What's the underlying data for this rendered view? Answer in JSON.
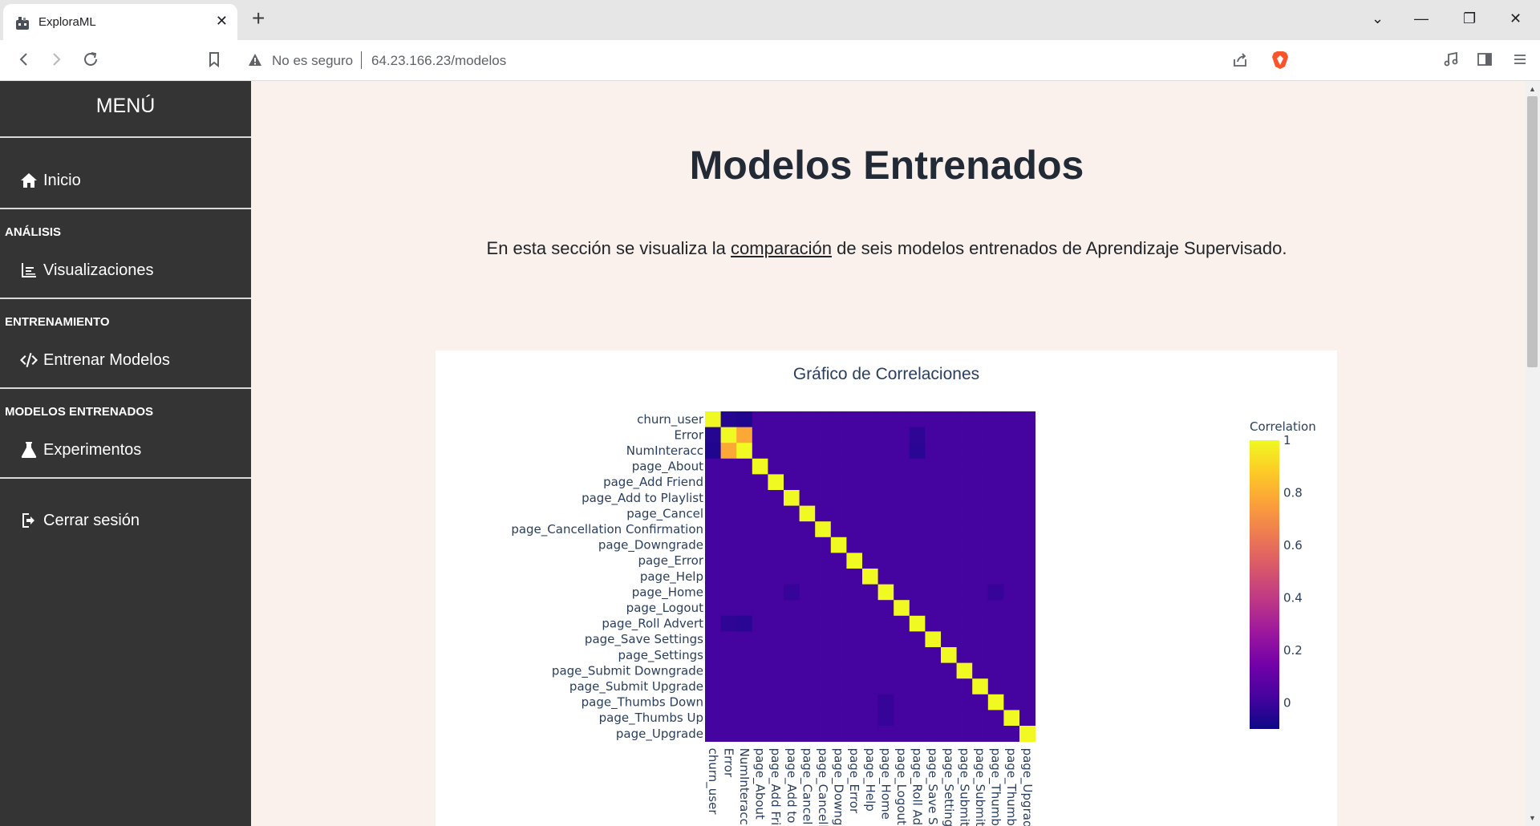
{
  "browser": {
    "tab_title": "ExploraML",
    "tab_close": "✕",
    "new_tab": "+",
    "insecure_label": "No es seguro",
    "url": "64.23.166.23/modelos",
    "window_controls": [
      "⌄",
      "—",
      "❐",
      "✕"
    ]
  },
  "sidebar": {
    "menu_title": "MENÚ",
    "home_label": "Inicio",
    "section_analysis": "ANÁLISIS",
    "visualizations_label": "Visualizaciones",
    "section_training": "ENTRENAMIENTO",
    "train_label": "Entrenar Modelos",
    "section_models": "MODELOS ENTRENADOS",
    "experiments_label": "Experimentos",
    "logout_label": "Cerrar sesión"
  },
  "main": {
    "title": "Modelos Entrenados",
    "intro_before": "En esta sección se visualiza la ",
    "intro_link": "comparación",
    "intro_after": " de seis modelos entrenados de Aprendizaje Supervisado."
  },
  "chart_data": {
    "type": "heatmap",
    "title": "Gráfico de Correlaciones",
    "colorbar_title": "Correlation",
    "colorbar_ticks": [
      "1",
      "0.8",
      "0.6",
      "0.4",
      "0.2",
      "0"
    ],
    "colorscale": [
      "#0d0887",
      "#46039f",
      "#7201a8",
      "#9c179e",
      "#bd3786",
      "#d8576b",
      "#ed7953",
      "#fb9f3a",
      "#fdca26",
      "#f0f921"
    ],
    "y_labels": [
      "churn_user",
      "Error",
      "NumInteracc",
      "page_About",
      "page_Add Friend",
      "page_Add to Playlist",
      "page_Cancel",
      "page_Cancellation Confirmation",
      "page_Downgrade",
      "page_Error",
      "page_Help",
      "page_Home",
      "page_Logout",
      "page_Roll Advert",
      "page_Save Settings",
      "page_Settings",
      "page_Submit Downgrade",
      "page_Submit Upgrade",
      "page_Thumbs Down",
      "page_Thumbs Up",
      "page_Upgrade"
    ],
    "x_labels": [
      "churn_user",
      "Error",
      "NumInteracc",
      "page_About",
      "page_Add Fri",
      "page_Add to",
      "page_Cancel",
      "page_Cancell",
      "page_Downg",
      "page_Error",
      "page_Help",
      "page_Home",
      "page_Logout",
      "page_Roll Ad",
      "page_Save S",
      "page_Setting",
      "page_Submit",
      "page_Submit",
      "page_Thumb",
      "page_Thumb",
      "page_Upgrad"
    ],
    "zlim": [
      -0.1,
      1
    ],
    "off_diagonal_value": 0.02,
    "overrides": [
      {
        "row": 0,
        "col": 1,
        "value": -0.05
      },
      {
        "row": 0,
        "col": 2,
        "value": -0.06
      },
      {
        "row": 1,
        "col": 0,
        "value": -0.05
      },
      {
        "row": 2,
        "col": 0,
        "value": -0.06
      },
      {
        "row": 1,
        "col": 2,
        "value": 0.78
      },
      {
        "row": 2,
        "col": 1,
        "value": 0.78
      },
      {
        "row": 1,
        "col": 13,
        "value": -0.03
      },
      {
        "row": 2,
        "col": 13,
        "value": -0.04
      },
      {
        "row": 13,
        "col": 1,
        "value": -0.03
      },
      {
        "row": 13,
        "col": 2,
        "value": -0.04
      },
      {
        "row": 11,
        "col": 5,
        "value": -0.01
      },
      {
        "row": 11,
        "col": 18,
        "value": -0.01
      },
      {
        "row": 18,
        "col": 11,
        "value": -0.01
      },
      {
        "row": 19,
        "col": 11,
        "value": -0.01
      }
    ]
  }
}
